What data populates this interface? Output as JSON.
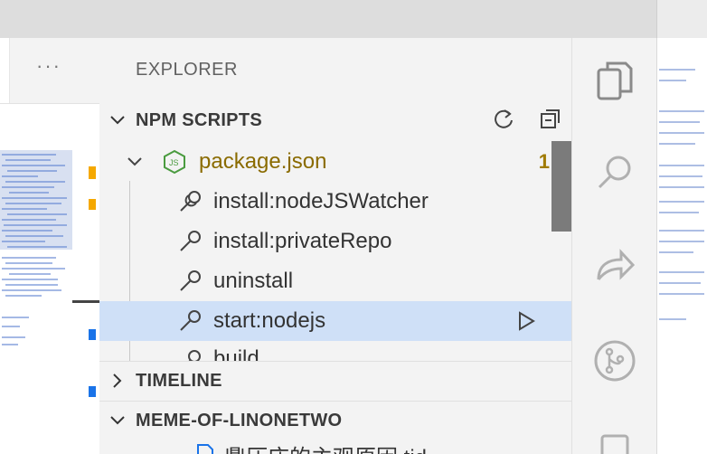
{
  "explorer": {
    "title": "EXPLORER",
    "npm_scripts": {
      "header": "NPM SCRIPTS",
      "package": {
        "name": "package.json",
        "badge": "1"
      },
      "scripts": [
        {
          "label": "install:nodeJSWatcher"
        },
        {
          "label": "install:privateRepo"
        },
        {
          "label": "uninstall"
        },
        {
          "label": "start:nodejs"
        },
        {
          "label": "build"
        }
      ]
    },
    "timeline": {
      "header": "TIMELINE"
    },
    "workspace": {
      "header": "MEME-OF-LINONETWO",
      "first_file": "鼎压床的主观原因.tid"
    }
  },
  "left_tabs": {
    "more": "···"
  },
  "colors": {
    "selected_row": "#cfe0f7",
    "package_name": "#8a6b00",
    "node_green": "#4a9b3f",
    "accent_blue": "#1a73e8"
  },
  "activity_bar": {
    "icons": [
      "files-icon",
      "search-icon",
      "source-share-icon",
      "git-branch-icon",
      "extensions-icon"
    ]
  }
}
